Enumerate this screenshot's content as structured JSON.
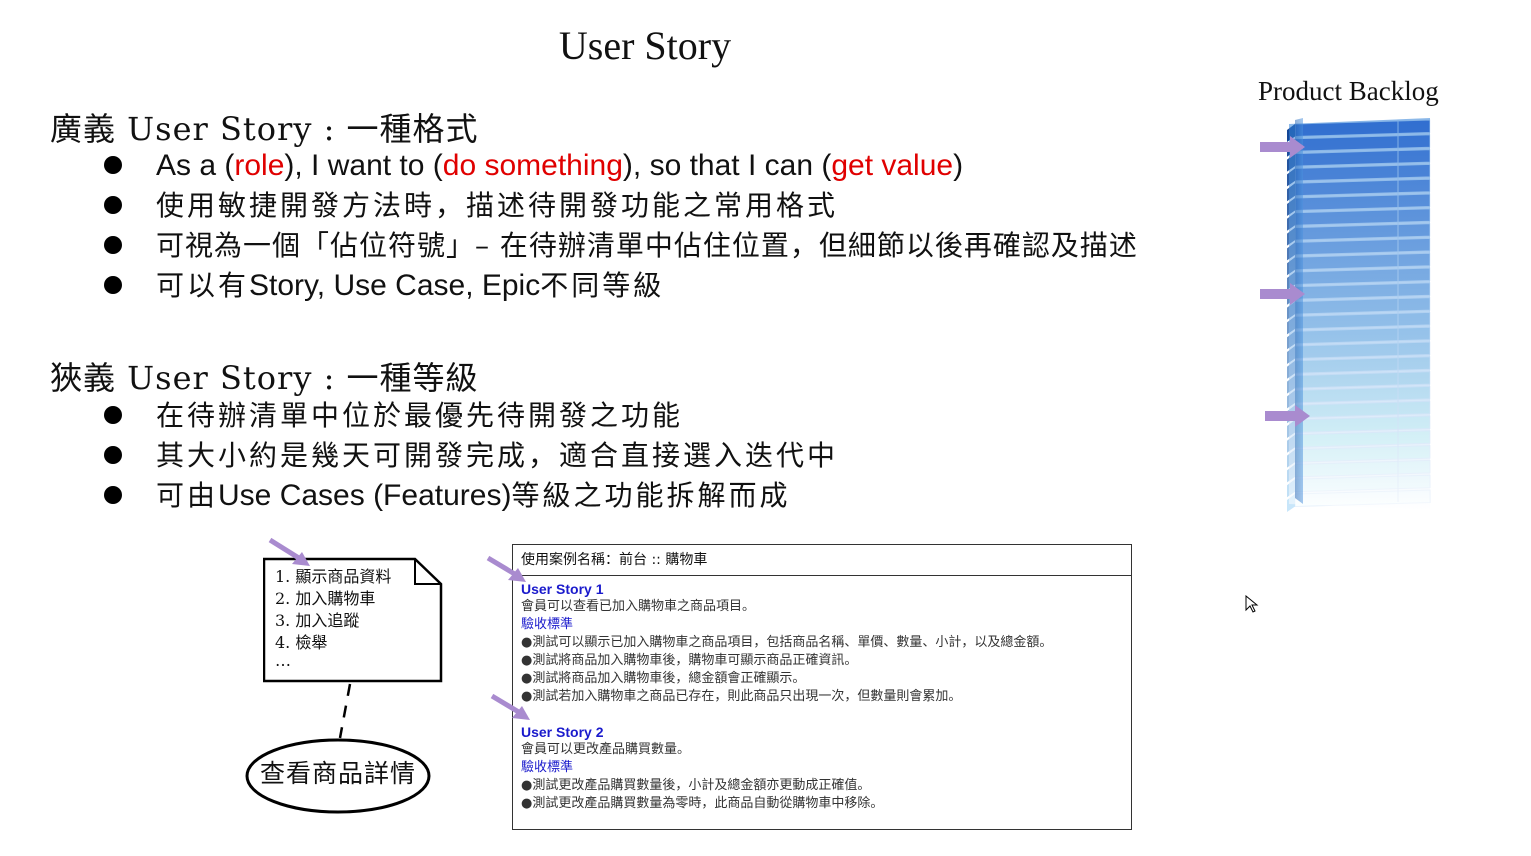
{
  "slide": {
    "title": "User Story",
    "broad": {
      "heading": "廣義 User Story : 一種格式",
      "bullets": [
        {
          "parts": [
            {
              "text": "As a (",
              "color": "black"
            },
            {
              "text": "role",
              "color": "red"
            },
            {
              "text": "), I want to (",
              "color": "black"
            },
            {
              "text": "do something",
              "color": "red"
            },
            {
              "text": "), so that I can (",
              "color": "black"
            },
            {
              "text": "get value",
              "color": "red"
            },
            {
              "text": ")",
              "color": "black"
            }
          ]
        },
        {
          "text": "使用敏捷開發方法時，描述待開發功能之常用格式"
        },
        {
          "text": "可視為一個「佔位符號」– 在待辦清單中佔住位置，但細節以後再確認及描述"
        },
        {
          "text_a": "可以有",
          "text_b": "Story, Use Case, Epic",
          "text_c": "不同等級"
        }
      ]
    },
    "narrow": {
      "heading": "狹義 User Story : 一種等級",
      "bullets": [
        {
          "text": "在待辦清單中位於最優先待開發之功能"
        },
        {
          "text": "其大小約是幾天可開發完成，適合直接選入迭代中"
        },
        {
          "text_a": "可由",
          "text_b": "Use Cases (Features)",
          "text_c": "等級之功能拆解而成"
        }
      ]
    },
    "backlog_label": "Product Backlog",
    "note_lines": [
      "1. 顯示商品資料",
      "2. 加入購物車",
      "3. 加入追蹤",
      "4. 檢舉",
      "…"
    ],
    "use_case": "查看商品詳情",
    "panel": {
      "header": "使用案例名稱：前台 :: 購物車",
      "story1_title": "User Story 1",
      "story1_desc": "會員可以查看已加入購物車之商品項目。",
      "criteria_label": "驗收標準",
      "story1_tests": [
        "●測試可以顯示已加入購物車之商品項目，包括商品名稱、單價、數量、小計，以及總金額。",
        "●測試將商品加入購物車後，購物車可顯示商品正確資訊。",
        "●測試將商品加入購物車後，總金額會正確顯示。",
        "●測試若加入購物車之商品已存在，則此商品只出現一次，但數量則會累加。"
      ],
      "story2_title": "User Story 2",
      "story2_desc": "會員可以更改產品購買數量。",
      "story2_tests": [
        "●測試更改產品購買數量後，小計及總金額亦更動成正確值。",
        "●測試更改產品購買數量為零時，此商品自動從購物車中移除。"
      ]
    },
    "colors": {
      "accent_red": "#e00000",
      "story_blue": "#1a1acc",
      "arrow_purple": "#a98bcf",
      "backlog_blue": "#2f7fd6"
    }
  }
}
